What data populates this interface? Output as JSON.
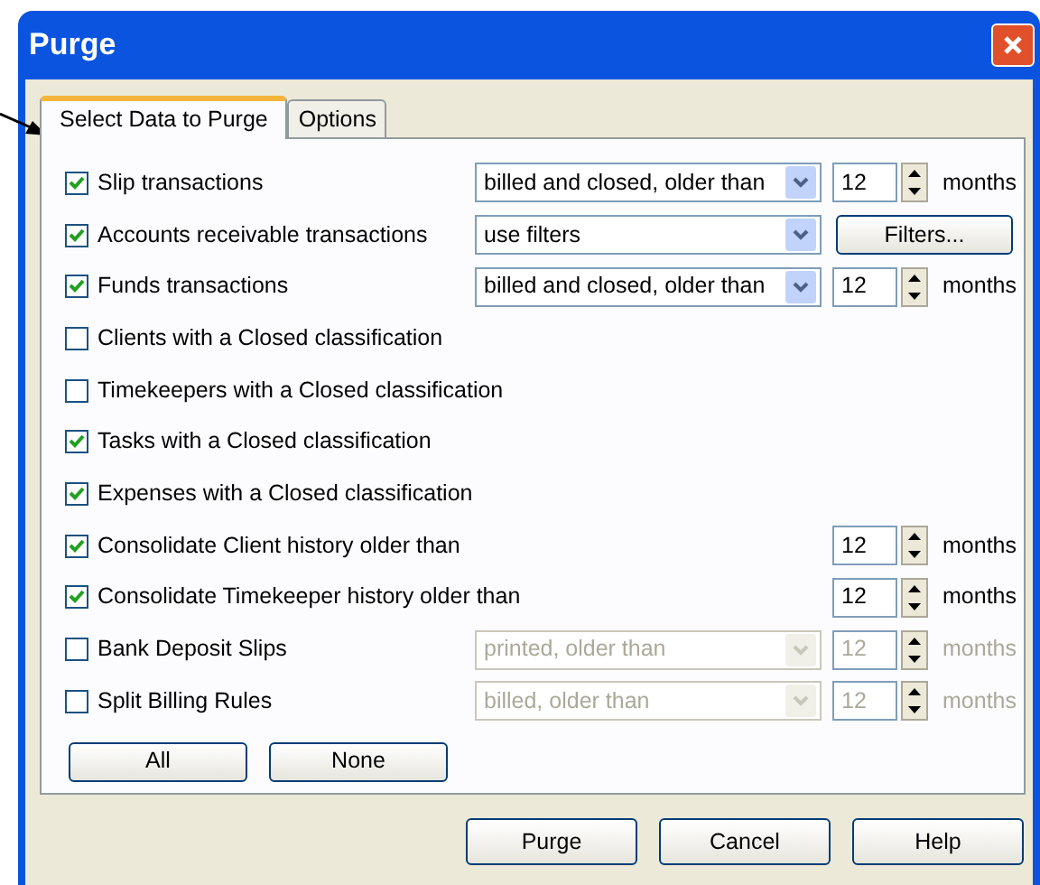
{
  "window": {
    "title": "Purge"
  },
  "tabs": [
    {
      "label": "Select Data to Purge",
      "selected": true
    },
    {
      "label": "Options",
      "selected": false
    }
  ],
  "rows": [
    {
      "kind": "combo_spin",
      "label": "Slip transactions",
      "checked": true,
      "disabled": false,
      "combo": "billed and closed, older than",
      "spin": "12",
      "unit": "months"
    },
    {
      "kind": "combo_button",
      "label": "Accounts receivable transactions",
      "checked": true,
      "disabled": false,
      "combo": "use filters",
      "button": "Filters..."
    },
    {
      "kind": "combo_spin",
      "label": "Funds transactions",
      "checked": true,
      "disabled": false,
      "combo": "billed and closed, older than",
      "spin": "12",
      "unit": "months"
    },
    {
      "kind": "plain",
      "label": "Clients with a Closed classification",
      "checked": false
    },
    {
      "kind": "plain",
      "label": "Timekeepers with a Closed classification",
      "checked": false
    },
    {
      "kind": "plain",
      "label": "Tasks with a Closed classification",
      "checked": true
    },
    {
      "kind": "plain",
      "label": "Expenses with a Closed classification",
      "checked": true
    },
    {
      "kind": "spin",
      "label": "Consolidate Client history older than",
      "checked": true,
      "disabled": false,
      "spin": "12",
      "unit": "months"
    },
    {
      "kind": "spin",
      "label": "Consolidate Timekeeper history older than",
      "checked": true,
      "disabled": false,
      "spin": "12",
      "unit": "months"
    },
    {
      "kind": "combo_spin",
      "label": "Bank Deposit Slips",
      "checked": false,
      "disabled": true,
      "combo": "printed, older than",
      "spin": "12",
      "unit": "months"
    },
    {
      "kind": "combo_spin",
      "label": "Split Billing Rules",
      "checked": false,
      "disabled": true,
      "combo": "billed, older than",
      "spin": "12",
      "unit": "months"
    }
  ],
  "panel_buttons": [
    "All",
    "None"
  ],
  "buttons": [
    "Purge",
    "Cancel",
    "Help"
  ]
}
